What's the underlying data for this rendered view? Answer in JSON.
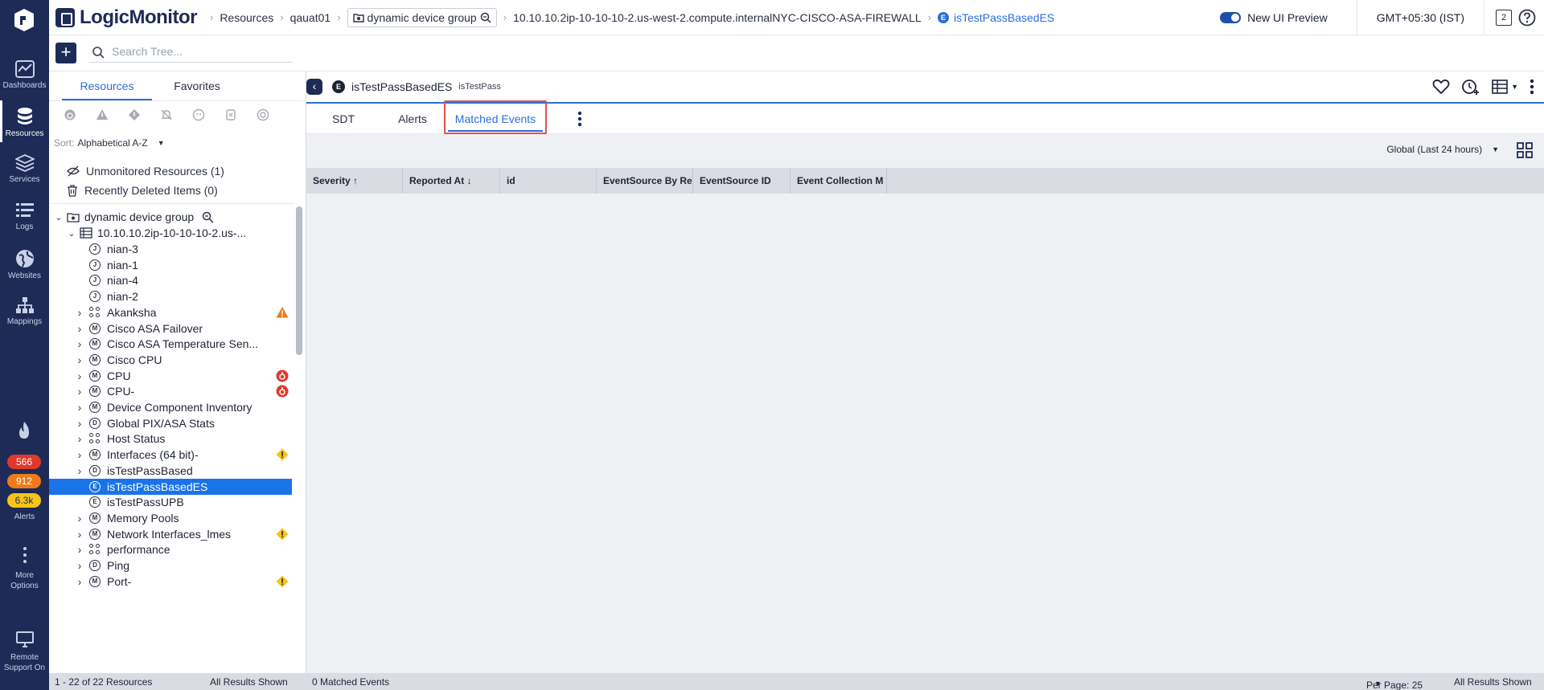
{
  "app": {
    "brand": "LogicMonitor"
  },
  "nav": {
    "items": [
      {
        "label": "Dashboards",
        "icon": "dashboard-icon"
      },
      {
        "label": "Resources",
        "icon": "database-icon"
      },
      {
        "label": "Services",
        "icon": "layers-icon"
      },
      {
        "label": "Logs",
        "icon": "logs-icon"
      },
      {
        "label": "Websites",
        "icon": "globe-icon"
      },
      {
        "label": "Mappings",
        "icon": "topology-icon"
      }
    ],
    "alerts": {
      "label": "Alerts",
      "critical": "566",
      "error": "912",
      "warning": "6.3k"
    },
    "more": "More Options",
    "remote": "Remote Support On"
  },
  "breadcrumbs": {
    "items": [
      "Resources",
      "qauat01",
      "dynamic device group",
      "10.10.10.2ip-10-10-10-2.us-west-2.compute.internalNYC-CISCO-ASA-FIREWALL"
    ],
    "current": "isTestPassBasedES"
  },
  "topbar": {
    "new_ui_label": "New UI Preview",
    "timezone": "GMT+05:30 (IST)",
    "notif_count": "2"
  },
  "search": {
    "placeholder": "Search Tree..."
  },
  "tree": {
    "tabs": [
      "Resources",
      "Favorites"
    ],
    "sort_label": "Sort:",
    "sort_value": "Alphabetical A-Z",
    "unmonitored": "Unmonitored Resources (1)",
    "recently_deleted": "Recently Deleted Items (0)",
    "group": "dynamic device group",
    "device": "10.10.10.2ip-10-10-10-2.us-...",
    "rows": [
      {
        "label": "nian-3",
        "type": "J"
      },
      {
        "label": "nian-1",
        "type": "J"
      },
      {
        "label": "nian-4",
        "type": "J"
      },
      {
        "label": "nian-2",
        "type": "J"
      },
      {
        "label": "Akanksha",
        "type": "dots",
        "status": "warning"
      },
      {
        "label": "Cisco ASA Failover",
        "type": "M"
      },
      {
        "label": "Cisco ASA Temperature Sen...",
        "type": "M"
      },
      {
        "label": "Cisco CPU",
        "type": "M"
      },
      {
        "label": "CPU",
        "type": "M",
        "status": "critical"
      },
      {
        "label": "CPU-",
        "type": "M",
        "status": "critical"
      },
      {
        "label": "Device Component Inventory",
        "type": "M"
      },
      {
        "label": "Global PIX/ASA Stats",
        "type": "D"
      },
      {
        "label": "Host Status",
        "type": "dots"
      },
      {
        "label": "Interfaces (64 bit)-",
        "type": "M",
        "status": "minor"
      },
      {
        "label": "isTestPassBased",
        "type": "D"
      },
      {
        "label": "isTestPassBasedES",
        "type": "E",
        "selected": true
      },
      {
        "label": "isTestPassUPB",
        "type": "E"
      },
      {
        "label": "Memory Pools",
        "type": "M"
      },
      {
        "label": "Network Interfaces_lmes",
        "type": "M",
        "status": "minor"
      },
      {
        "label": "performance",
        "type": "dots"
      },
      {
        "label": "Ping",
        "type": "D"
      },
      {
        "label": "Port-",
        "type": "M",
        "status": "minor"
      }
    ]
  },
  "detail": {
    "title": "isTestPassBasedES",
    "subtitle": "isTestPass",
    "tabs": [
      "SDT",
      "Alerts",
      "Matched Events"
    ],
    "active_tab": "Matched Events",
    "range": "Global (Last 24 hours)",
    "columns": [
      "Severity",
      "Reported At",
      "id",
      "EventSource By Re",
      "EventSource ID",
      "Event Collection M"
    ]
  },
  "footer": {
    "resources": "1 - 22 of 22 Resources",
    "shown_left": "All Results Shown",
    "matched": "0 Matched Events",
    "per_page": "Per Page: 25",
    "shown_right": "All Results Shown"
  },
  "colors": {
    "nav_bg": "#1e2b57",
    "accent": "#2a6fd8",
    "selected": "#1a73e8",
    "critical": "#e0392c",
    "error": "#f07a1a",
    "warning": "#f5c518",
    "highlight": "#e2514a"
  }
}
